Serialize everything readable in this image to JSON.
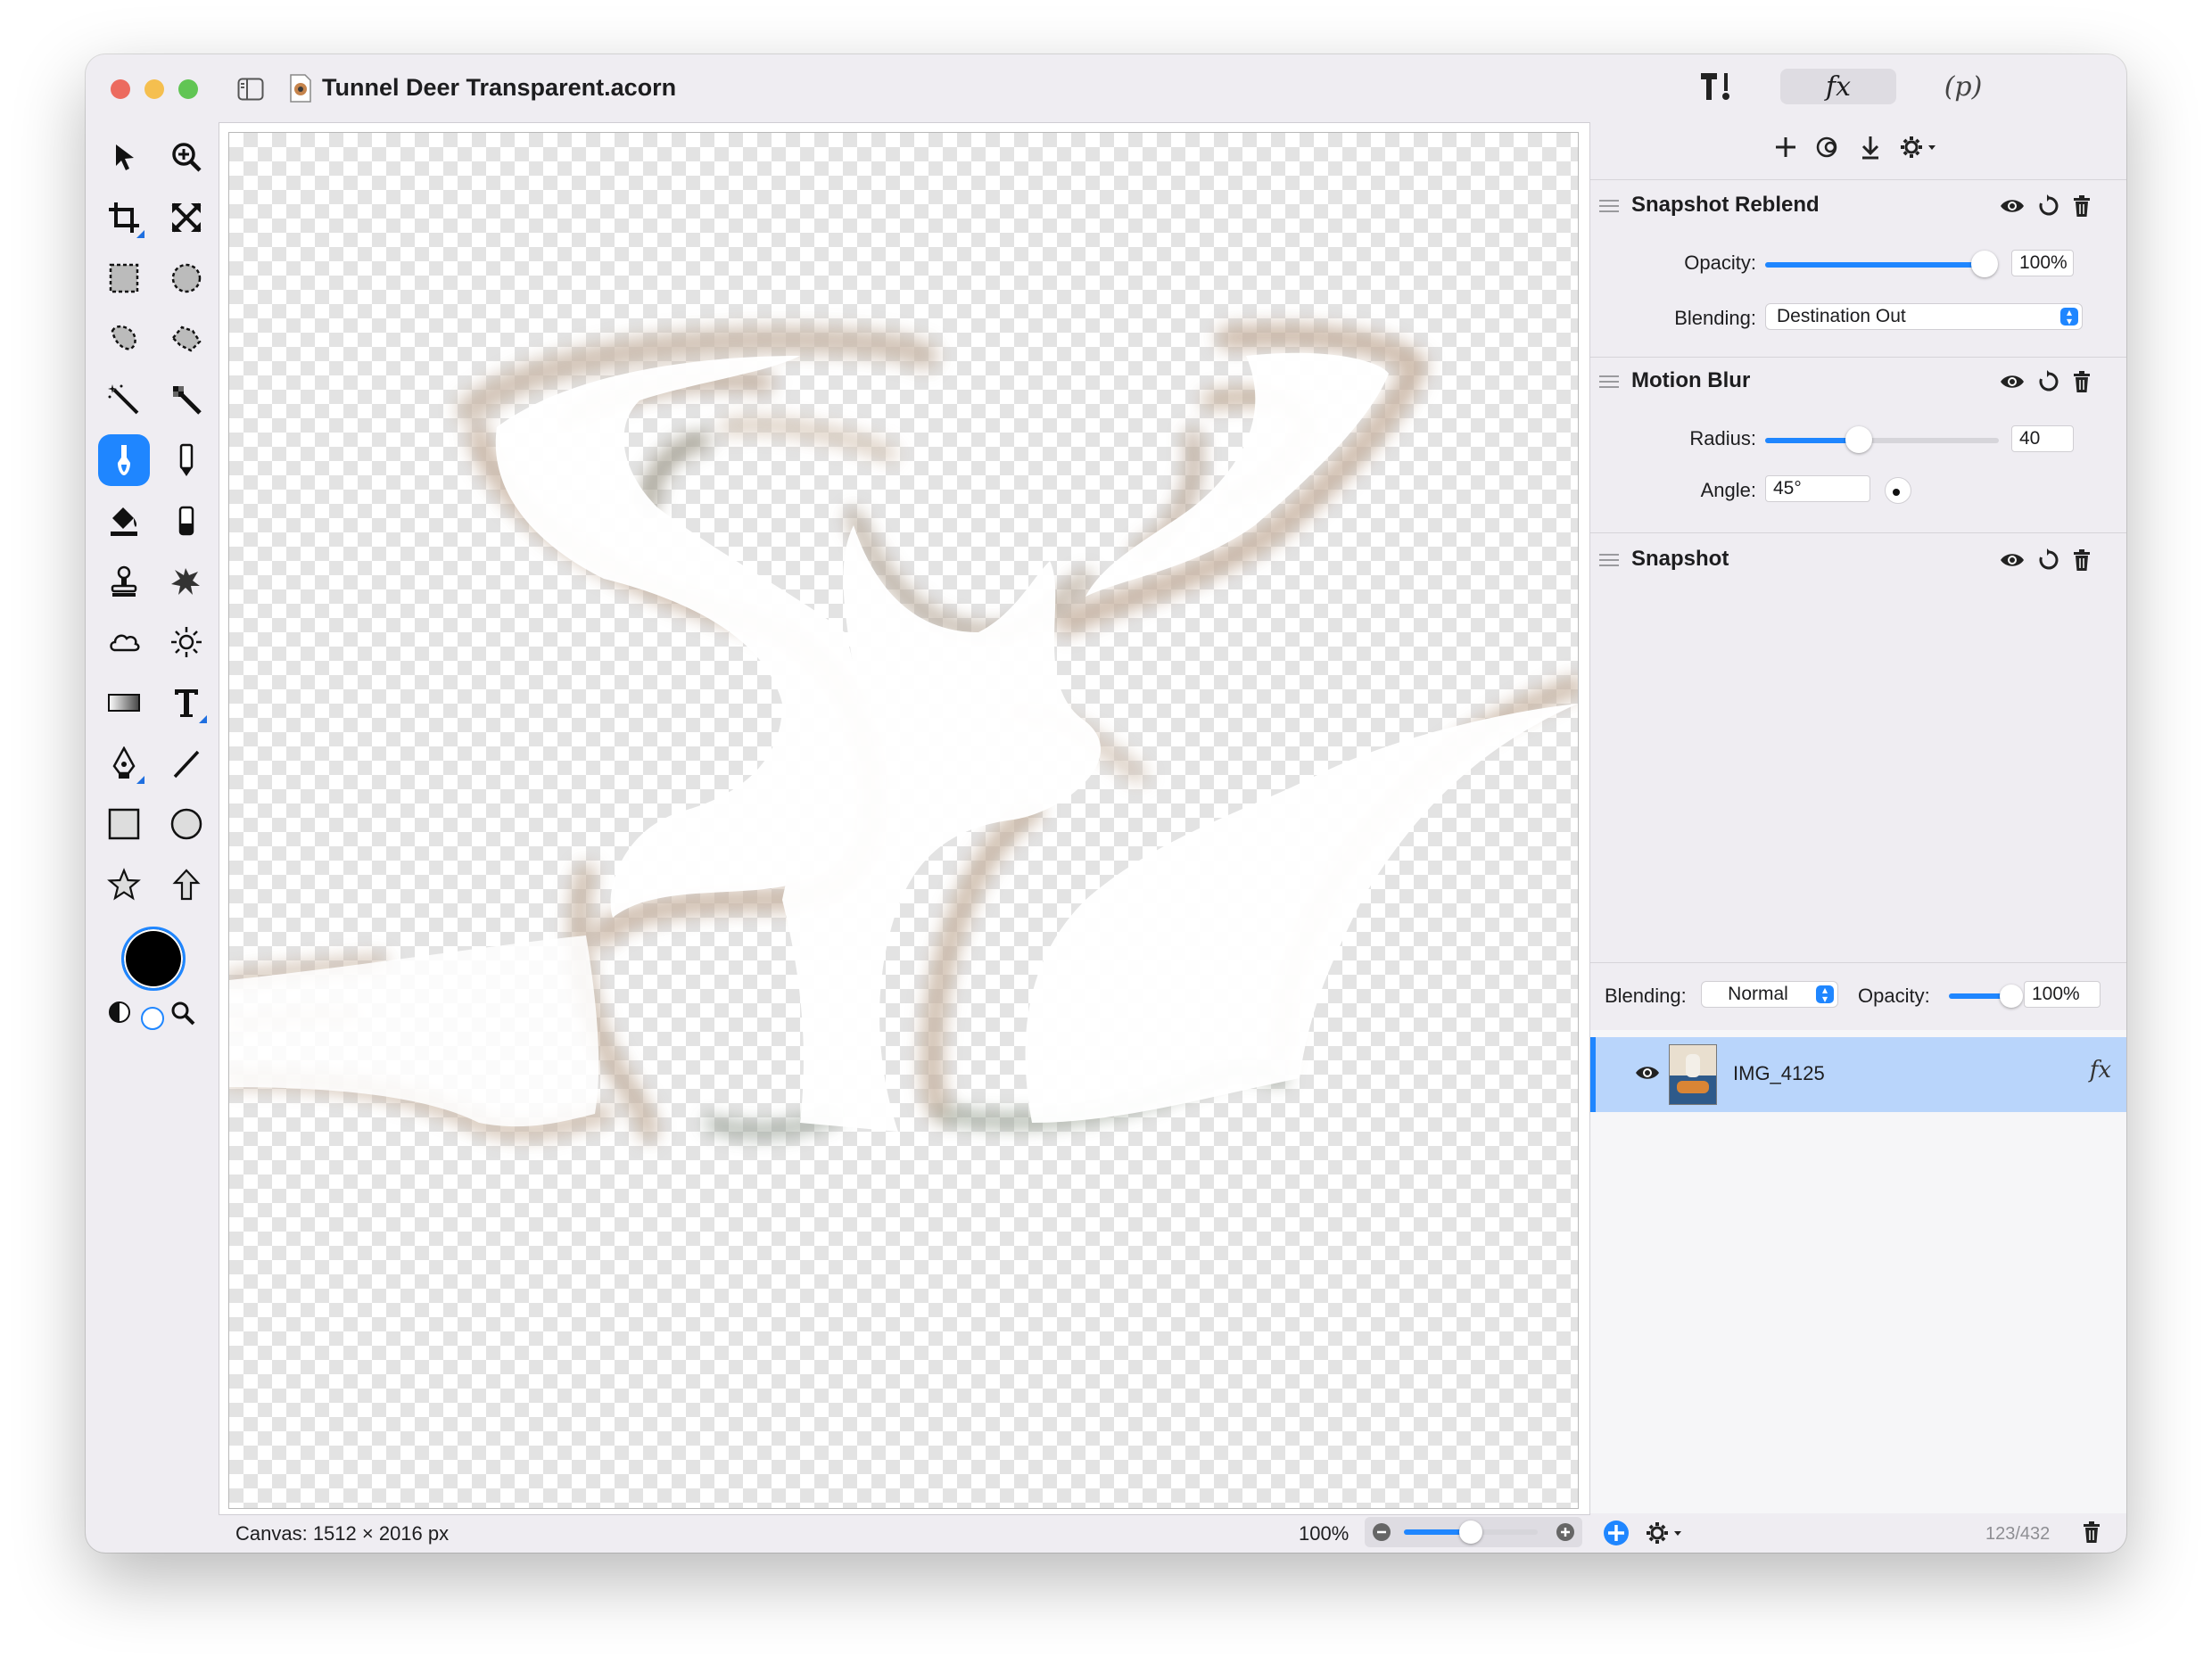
{
  "window": {
    "title": "Tunnel Deer Transparent.acorn",
    "traffic_lights": [
      "#ec6b5f",
      "#f5bf4f",
      "#61c554"
    ]
  },
  "toolbar": {
    "tools_icon": "hammer-wrench-icon",
    "fx_label": "fx",
    "p_label": "(p)"
  },
  "filter_toolbar": {
    "icons": [
      "plus-icon",
      "filter-chain-icon",
      "download-icon",
      "gear-icon"
    ]
  },
  "filters": [
    {
      "name": "Snapshot Reblend",
      "opacity_label": "Opacity:",
      "opacity_value": "100%",
      "opacity_fraction": 1.0,
      "blending_label": "Blending:",
      "blending_value": "Destination Out"
    },
    {
      "name": "Motion Blur",
      "radius_label": "Radius:",
      "radius_value": "40",
      "radius_fraction": 0.4,
      "angle_label": "Angle:",
      "angle_value": "45°"
    },
    {
      "name": "Snapshot"
    }
  ],
  "layer_controls": {
    "blending_label": "Blending:",
    "blending_value": "Normal",
    "opacity_label": "Opacity:",
    "opacity_value": "100%",
    "opacity_fraction": 1.0
  },
  "layers": [
    {
      "name": "IMG_4125",
      "fx_badge": "fx",
      "visible": true
    }
  ],
  "status": {
    "canvas_info": "Canvas: 1512 × 2016 px",
    "zoom": "100%",
    "zoom_fraction": 0.5,
    "memory": "123/432"
  },
  "colors": {
    "accent": "#1f86ff",
    "selected_row": "#b9d5fb",
    "foreground_swatch": "#000000"
  }
}
